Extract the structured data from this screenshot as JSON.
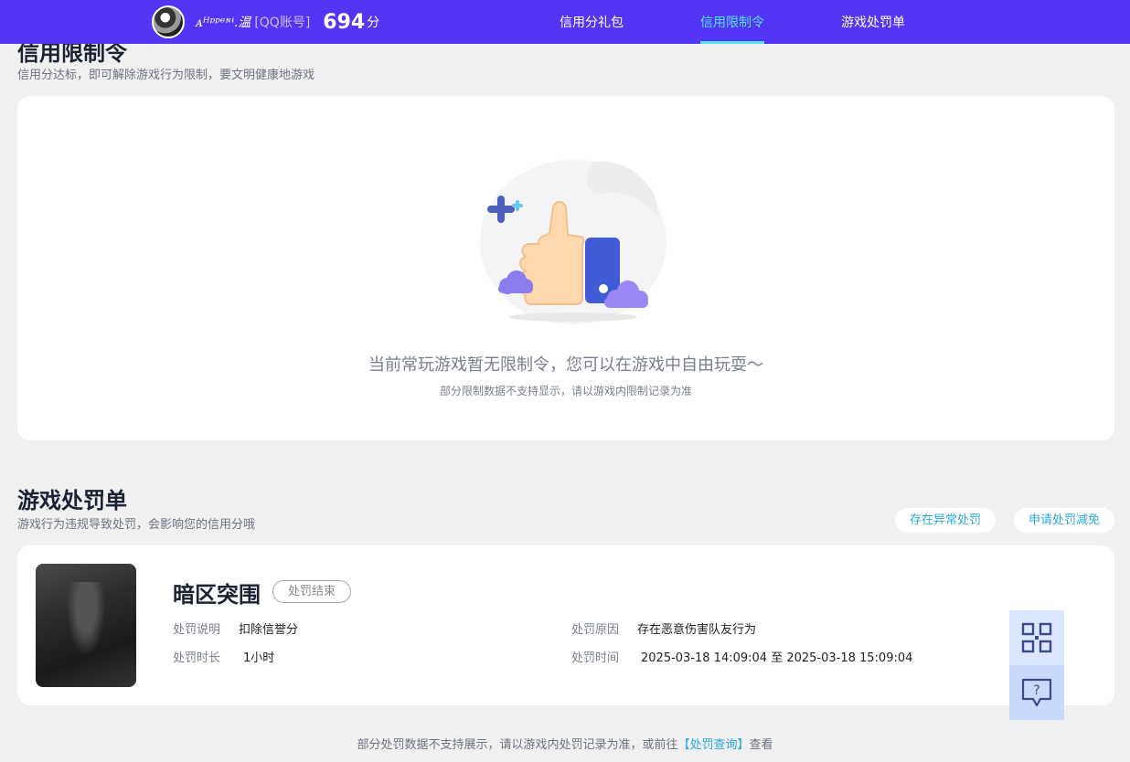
{
  "header": {
    "username": "ᴀᴴᵖᵖᵉᶰᶤ.温",
    "account_type": "[QQ账号]",
    "score": "694",
    "score_unit": "分",
    "nav": [
      {
        "label": "信用分礼包",
        "active": false
      },
      {
        "label": "信用限制令",
        "active": true
      },
      {
        "label": "游戏处罚单",
        "active": false
      }
    ]
  },
  "restriction": {
    "title": "信用限制令",
    "subtitle": "信用分达标，即可解除游戏行为限制，要文明健康地游戏",
    "empty_main": "当前常玩游戏暂无限制令，您可以在游戏中自由玩耍～",
    "empty_sub": "部分限制数据不支持显示，请以游戏内限制记录为准"
  },
  "punishment": {
    "title": "游戏处罚单",
    "subtitle": "游戏行为违规导致处罚，会影响您的信用分哦",
    "buttons": {
      "abnormal": "存在异常处罚",
      "appeal": "申请处罚减免"
    },
    "record": {
      "game_name": "暗区突围",
      "status": "处罚结束",
      "desc_label": "处罚说明",
      "desc_value": "扣除信誉分",
      "duration_label": "处罚时长",
      "duration_value": "1小时",
      "reason_label": "处罚原因",
      "reason_value": "存在恶意伤害队友行为",
      "time_label": "处罚时间",
      "time_value": "2025-03-18 14:09:04 至 2025-03-18 15:09:04"
    }
  },
  "footer": {
    "note_prefix": "部分处罚数据不支持展示，请以游戏内处罚记录为准，或前往",
    "link": "【处罚查询】",
    "note_suffix": "查看"
  },
  "colors": {
    "brand": "#5335f5",
    "nav_active": "#54e0ff",
    "link": "#2aa9e0"
  },
  "icons": {
    "qr": "qr-code-icon",
    "help": "help-chat-icon"
  }
}
